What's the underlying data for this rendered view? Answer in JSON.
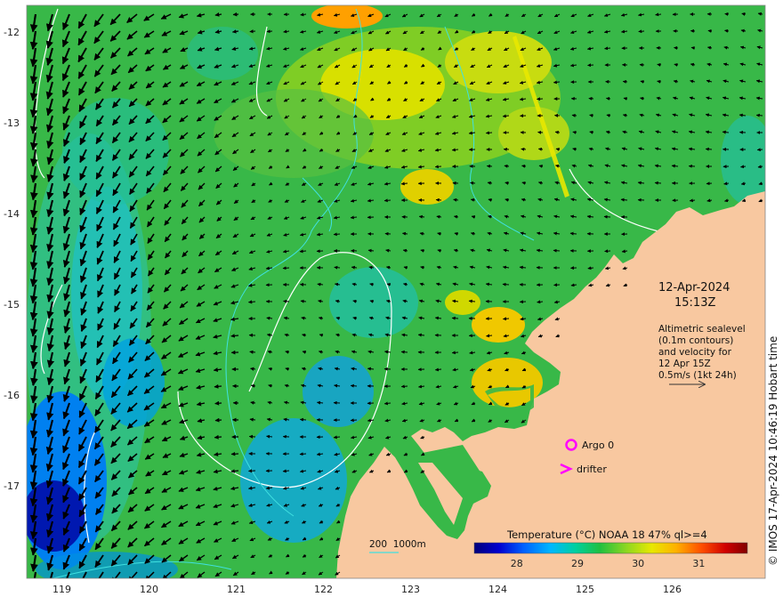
{
  "datetime": {
    "date": "12-Apr-2024",
    "time": "15:13Z"
  },
  "altimetry_note": [
    "Altimetric sealevel",
    "(0.1m contours)",
    "and velocity for",
    "12 Apr 15Z",
    "0.5m/s (1kt 24h)"
  ],
  "legend_markers": {
    "argo": "Argo 0",
    "drifter": "drifter"
  },
  "depth_legend": "200  1000m",
  "colorbar": {
    "title": "Temperature (°C) NOAA 18 47% ql>=4",
    "ticks": [
      "28",
      "29",
      "30",
      "31"
    ],
    "range": [
      27.3,
      31.8
    ],
    "colors": [
      "#00007a",
      "#0000d0",
      "#0060ff",
      "#00b8ff",
      "#00d0a0",
      "#20c040",
      "#90d820",
      "#e8e800",
      "#ffb000",
      "#ff5000",
      "#d00000",
      "#800000"
    ]
  },
  "lat_labels": [
    "-12",
    "-13",
    "-14",
    "-15",
    "-16",
    "-17"
  ],
  "lon_labels": [
    "119",
    "120",
    "121",
    "122",
    "123",
    "124",
    "125",
    "126"
  ],
  "credit": "© IMOS 17-Apr-2024 10:46:19 Hobart time",
  "colors": {
    "land": "#f8c8a0",
    "argo": "#ff00ff",
    "drifter": "#ff00ff",
    "depth_contour": "#40e0e0",
    "sealevel_contour": "#ffffff"
  }
}
